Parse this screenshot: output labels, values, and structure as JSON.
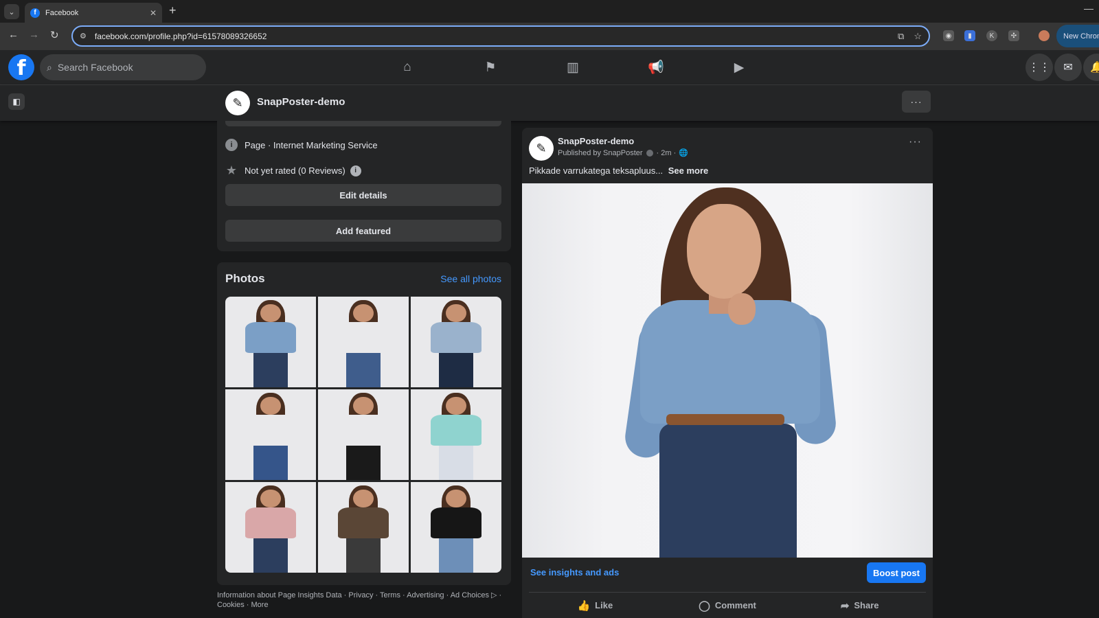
{
  "browser": {
    "tab_title": "Facebook",
    "new_tab": "+",
    "url": "facebook.com/profile.php?id=61578089326652",
    "profile_button": "New Chrom"
  },
  "fb": {
    "search_placeholder": "Search Facebook"
  },
  "page_header": {
    "page_name": "SnapPoster-demo",
    "more": "···"
  },
  "intro": {
    "category": "Page · Internet Marketing Service",
    "rating": "Not yet rated (0 Reviews)",
    "edit_details": "Edit details",
    "add_featured": "Add featured"
  },
  "photos": {
    "title": "Photos",
    "see_all": "See all photos",
    "items": [
      {
        "name": "photo-denim-shirt",
        "top": "#7b9fc6",
        "legs": "#2c3e5e"
      },
      {
        "name": "photo-jeans-blue",
        "top": "#e9e9eb",
        "legs": "#3f5d8c"
      },
      {
        "name": "photo-jeans-dark",
        "top": "#9ab2cc",
        "legs": "#1e2c44"
      },
      {
        "name": "photo-flare-jeans",
        "top": "#e9e9eb",
        "legs": "#35558a"
      },
      {
        "name": "photo-black-culottes",
        "top": "#e9e9eb",
        "legs": "#1a1a1a"
      },
      {
        "name": "photo-dirndl-dress",
        "top": "#8fd3cf",
        "legs": "#d8dde6"
      },
      {
        "name": "photo-pink-cardigan",
        "top": "#d9a7a8",
        "legs": "#2c3e5e"
      },
      {
        "name": "photo-leopard-top",
        "top": "#5a4636",
        "legs": "#3a3a3a"
      },
      {
        "name": "photo-black-tee",
        "top": "#161616",
        "legs": "#6d8fb8"
      }
    ]
  },
  "footer": {
    "links": "Information about Page Insights Data · Privacy · Terms · Advertising · Ad Choices ▷ · Cookies · More"
  },
  "post": {
    "author": "SnapPoster-demo",
    "published_by": "Published by SnapPoster",
    "time": "· 2m ·",
    "text": "Pikkade varrukatega teksapluus...",
    "see_more": "See more",
    "insights": "See insights and ads",
    "boost": "Boost post",
    "like": "Like",
    "comment": "Comment",
    "share": "Share"
  }
}
